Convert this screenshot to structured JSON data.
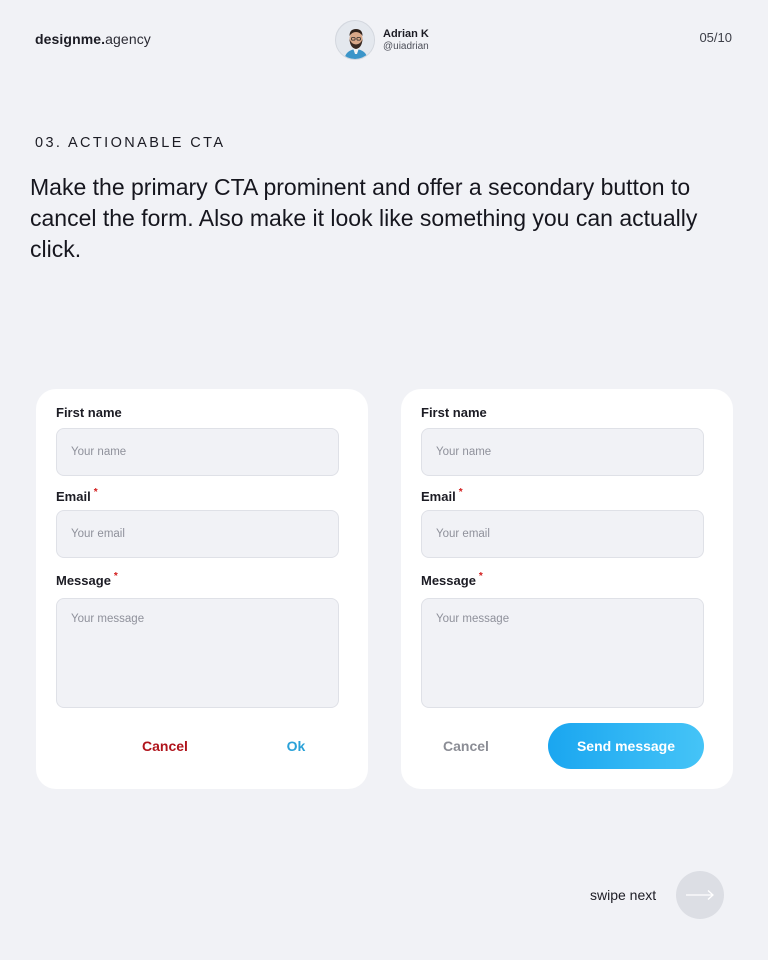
{
  "header": {
    "brand_bold": "designme.",
    "brand_light": "agency",
    "author_name": "Adrian K",
    "author_handle": "@uiadrian",
    "page_count": "05/10"
  },
  "section": {
    "label": "03. ACTIONABLE CTA",
    "headline": "Make the primary CTA prominent and offer a secondary button to cancel the form. Also make it look like something you can actually click."
  },
  "form_left": {
    "first_name_label": "First name",
    "first_name_placeholder": "Your name",
    "email_label": "Email",
    "email_placeholder": "Your email",
    "message_label": "Message",
    "message_placeholder": "Your message",
    "required_mark": "*",
    "cancel_label": "Cancel",
    "ok_label": "Ok"
  },
  "form_right": {
    "first_name_label": "First name",
    "first_name_placeholder": "Your name",
    "email_label": "Email",
    "email_placeholder": "Your email",
    "message_label": "Message",
    "message_placeholder": "Your message",
    "required_mark": "*",
    "cancel_label": "Cancel",
    "send_label": "Send message"
  },
  "footer": {
    "swipe_label": "swipe next",
    "swipe_icon": "arrow-right-icon"
  },
  "colors": {
    "background": "#f1f2f6",
    "card": "#ffffff",
    "cancel_red": "#b0141c",
    "ok_blue": "#2aa1d8",
    "cancel_grey": "#8b8d95",
    "send_gradient_start": "#1aa6f0",
    "send_gradient_end": "#45c4f7",
    "required": "#d21c1c"
  }
}
